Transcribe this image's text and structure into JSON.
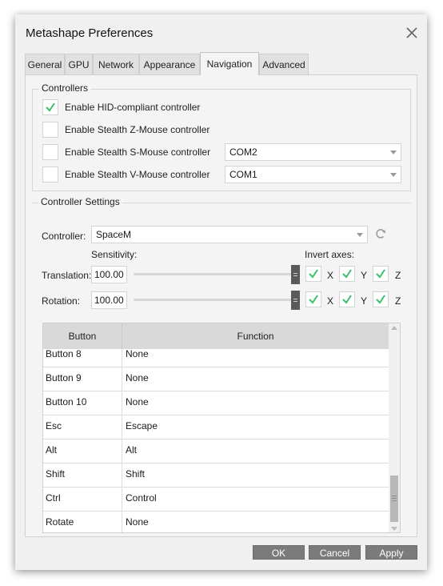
{
  "window": {
    "title": "Metashape Preferences"
  },
  "tabs": [
    "General",
    "GPU",
    "Network",
    "Appearance",
    "Navigation",
    "Advanced"
  ],
  "active_tab": "Navigation",
  "controllers": {
    "title": "Controllers",
    "items": [
      {
        "label": "Enable HID-compliant controller",
        "checked": true
      },
      {
        "label": "Enable Stealth Z-Mouse controller",
        "checked": false
      },
      {
        "label": "Enable Stealth S-Mouse controller",
        "checked": false,
        "port": "COM2"
      },
      {
        "label": "Enable Stealth V-Mouse controller",
        "checked": false,
        "port": "COM1"
      }
    ]
  },
  "settings": {
    "title": "Controller Settings",
    "controller_label": "Controller:",
    "controller_value": "SpaceM",
    "sensitivity_label": "Sensitivity:",
    "invert_label": "Invert axes:",
    "translation_label": "Translation:",
    "translation_value": "100.00",
    "rotation_label": "Rotation:",
    "rotation_value": "100.00",
    "axes": [
      "X",
      "Y",
      "Z"
    ]
  },
  "table": {
    "headers": [
      "Button",
      "Function"
    ],
    "rows": [
      [
        "Button 8",
        "None"
      ],
      [
        "Button 9",
        "None"
      ],
      [
        "Button 10",
        "None"
      ],
      [
        "Esc",
        "Escape"
      ],
      [
        "Alt",
        "Alt"
      ],
      [
        "Shift",
        "Shift"
      ],
      [
        "Ctrl",
        "Control"
      ],
      [
        "Rotate",
        "None"
      ]
    ]
  },
  "buttons": {
    "ok": "OK",
    "cancel": "Cancel",
    "apply": "Apply"
  },
  "colors": {
    "check": "#3bbf6a",
    "button_bg": "#7b7b7b",
    "slider_thumb": "#5a5a5a"
  }
}
